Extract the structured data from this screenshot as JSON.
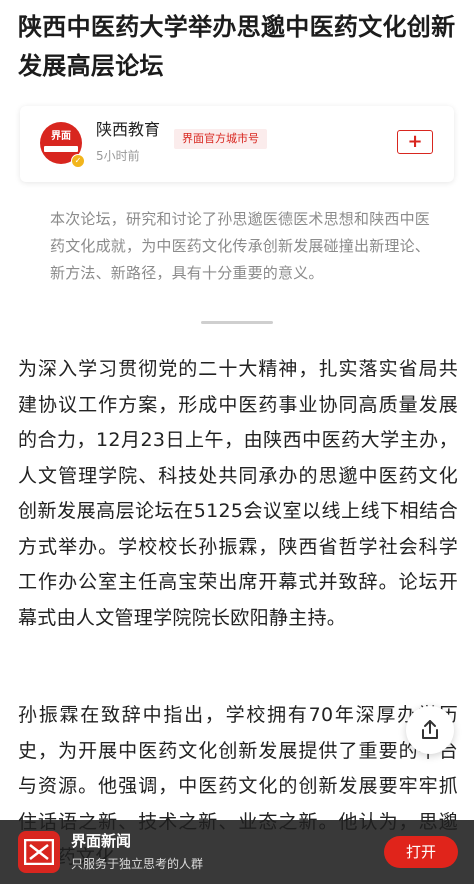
{
  "article": {
    "title": "陕西中医药大学举办思邈中医药文化创新发展高层论坛",
    "author": {
      "name": "陕西教育",
      "time": "5小时前",
      "tag": "界面官方城市号",
      "follow_label": "+",
      "avatar_text": "界面"
    },
    "summary": "本次论坛，研究和讨论了孙思邈医德医术思想和陕西中医药文化成就，为中医药文化传承创新发展碰撞出新理论、新方法、新路径，具有十分重要的意义。",
    "paragraphs": [
      "为深入学习贯彻党的二十大精神，扎实落实省局共建协议工作方案，形成中医药事业协同高质量发展的合力，12月23日上午，由陕西中医药大学主办，人文管理学院、科技处共同承办的思邈中医药文化创新发展高层论坛在5125会议室以线上线下相结合方式举办。学校校长孙振霖，陕西省哲学社会科学工作办公室主任高宝荣出席开幕式并致辞。论坛开幕式由人文管理学院院长欧阳静主持。",
      "孙振霖在致辞中指出，学校拥有70年深厚办学历史，为开展中医药文化创新发展提供了重要的平台与资源。他强调，中医药文化的创新发展要牢牢抓住话语之新、技术之新、业态之新。他认为，思邈中医药文化"
    ]
  },
  "app_banner": {
    "name": "界面新闻",
    "slogan": "只服务于独立思考的人群",
    "open_label": "打开"
  },
  "colors": {
    "brand": "#d8261f",
    "summary_text": "#8b8b8b",
    "banner_bg": "#1e1e1e"
  },
  "icons": {
    "share": "share-icon",
    "verify": "verified-badge-icon",
    "logo": "jiemian-logo-icon"
  }
}
